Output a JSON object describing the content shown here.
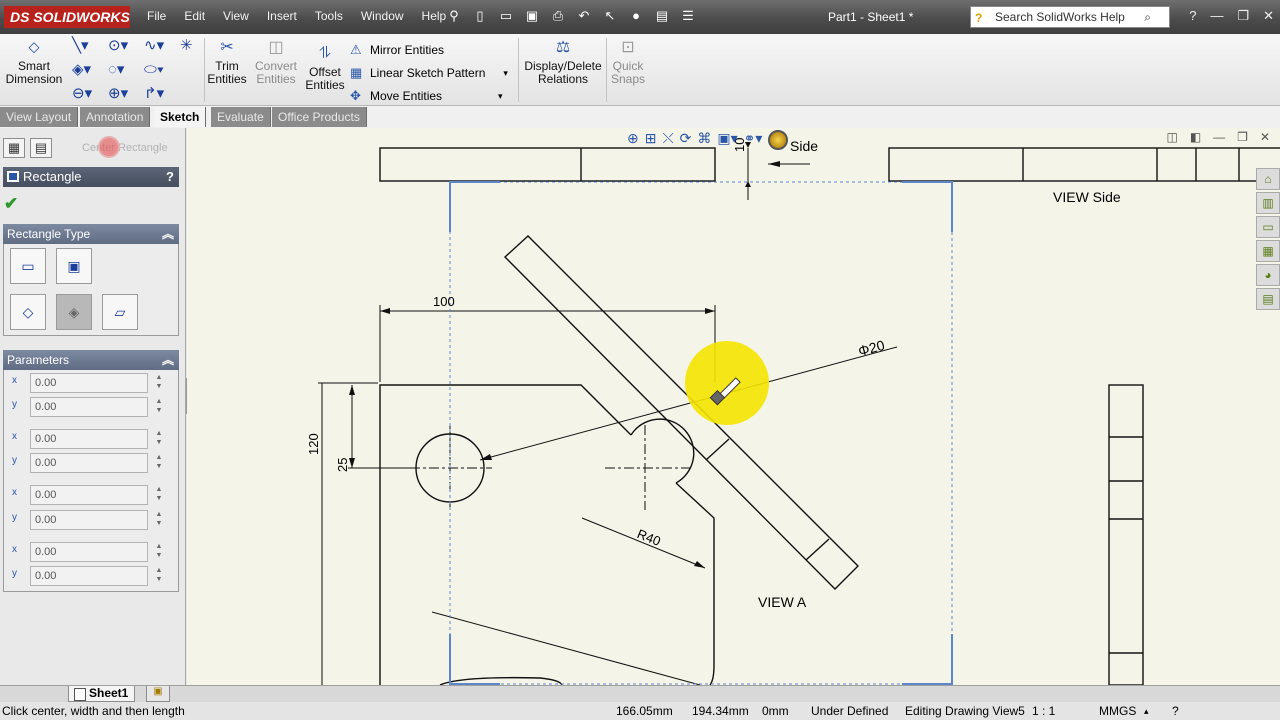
{
  "app": {
    "logo_text": "DS SOLIDWORKS",
    "document_title": "Part1 - Sheet1 *"
  },
  "menu": [
    "File",
    "Edit",
    "View",
    "Insert",
    "Tools",
    "Window",
    "Help"
  ],
  "search": {
    "placeholder": "Search SolidWorks Help"
  },
  "command_manager": {
    "smart_dimension": "Smart Dimension",
    "trim_entities": "Trim Entities",
    "convert_entities": "Convert Entities",
    "offset_entities": "Offset Entities",
    "mirror_entities": "Mirror Entities",
    "linear_sketch_pattern": "Linear Sketch Pattern",
    "move_entities": "Move Entities",
    "display_delete_relations": "Display/Delete Relations",
    "quick_snaps": "Quick Snaps"
  },
  "tabs": [
    {
      "label": "View Layout",
      "active": false
    },
    {
      "label": "Annotation",
      "active": false
    },
    {
      "label": "Sketch",
      "active": true
    },
    {
      "label": "Evaluate",
      "active": false
    },
    {
      "label": "Office Products",
      "active": false
    }
  ],
  "property_manager": {
    "ghost_tool": "Center Rectangle",
    "title": "Rectangle",
    "help": "?",
    "rectangle_type_label": "Rectangle Type",
    "parameters_label": "Parameters",
    "parameters": [
      {
        "axis": "x",
        "value": "0.00"
      },
      {
        "axis": "y",
        "value": "0.00"
      },
      {
        "axis": "x",
        "value": "0.00"
      },
      {
        "axis": "y",
        "value": "0.00"
      },
      {
        "axis": "x",
        "value": "0.00"
      },
      {
        "axis": "y",
        "value": "0.00"
      },
      {
        "axis": "x",
        "value": "0.00"
      },
      {
        "axis": "y",
        "value": "0.00"
      }
    ]
  },
  "drawing": {
    "dim_top_10": "10",
    "side_label": "Side",
    "view_side": "VIEW Side",
    "dim_100": "100",
    "dim_phi20": "Φ20",
    "dim_120": "120",
    "dim_25": "25",
    "dim_r40": "R40",
    "view_a": "VIEW A"
  },
  "sheet": {
    "tab_label": "Sheet1"
  },
  "status": {
    "prompt": "Click center, width and then length",
    "x": "166.05mm",
    "y": "194.34mm",
    "z": "0mm",
    "state": "Under Defined",
    "editing": "Editing Drawing View5",
    "scale": "1 : 1",
    "units": "MMGS"
  },
  "colors": {
    "canvas": "#f4f4e9",
    "view_border": "#5b86c9",
    "highlight": "#f5e600"
  }
}
